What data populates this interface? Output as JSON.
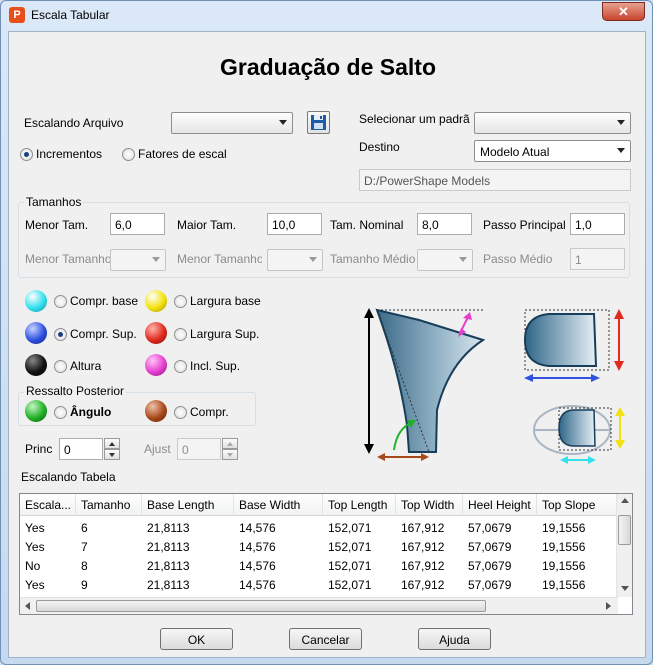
{
  "window": {
    "title": "Escala Tabular",
    "close": "✕"
  },
  "heading": "Graduação de Salto",
  "file": {
    "label": "Escalando Arquivo",
    "value": ""
  },
  "standard": {
    "label": "Selecionar um padrã",
    "value": ""
  },
  "mode": {
    "increments": "Incrementos",
    "factors": "Fatores de escal:",
    "selected": "increments"
  },
  "destination": {
    "label": "Destino",
    "value": "Modelo Atual",
    "path": "D:/PowerShape Models"
  },
  "sizes": {
    "title": "Tamanhos",
    "min_label": "Menor Tam.",
    "min": "6,0",
    "max_label": "Maior Tam.",
    "max": "10,0",
    "nominal_label": "Tam. Nominal",
    "nominal": "8,0",
    "step_label": "Passo Principal",
    "step": "1,0",
    "min2_label": "Menor Tamanho",
    "mid_label": "Tamanho Médio",
    "mid_step_label": "Passo Médio",
    "mid_step": "1"
  },
  "options": {
    "base_length": "Compr. base",
    "base_width": "Largura base",
    "top_length": "Compr. Sup.",
    "top_width": "Largura Sup.",
    "height": "Altura",
    "top_slope": "Incl. Sup.",
    "selected": "top_length"
  },
  "heel_back": {
    "title": "Ressalto Posterior",
    "angle": "Ângulo",
    "length": "Compr."
  },
  "princ": {
    "label": "Princ",
    "value": "0"
  },
  "ajust": {
    "label": "Ajust",
    "value": "0"
  },
  "table": {
    "title": "Escalando Tabela",
    "columns": [
      "Escala...",
      "Tamanho",
      "Base Length",
      "Base Width",
      "Top Length",
      "Top Width",
      "Heel Height",
      "Top Slope"
    ],
    "rows": [
      [
        "Yes",
        "6",
        "21,8113",
        "14,576",
        "152,071",
        "167,912",
        "57,0679",
        "19,1556"
      ],
      [
        "Yes",
        "7",
        "21,8113",
        "14,576",
        "152,071",
        "167,912",
        "57,0679",
        "19,1556"
      ],
      [
        "No",
        "8",
        "21,8113",
        "14,576",
        "152,071",
        "167,912",
        "57,0679",
        "19,1556"
      ],
      [
        "Yes",
        "9",
        "21,8113",
        "14,576",
        "152,071",
        "167,912",
        "57,0679",
        "19,1556"
      ]
    ]
  },
  "buttons": {
    "ok": "OK",
    "cancel": "Cancelar",
    "help": "Ajuda"
  },
  "colors": {
    "cyan": "#34e0ee",
    "blue": "#2f52e0",
    "black": "#111111",
    "yellow": "#f3e20c",
    "red": "#e02b1d",
    "magenta": "#e63fd0",
    "green": "#22b126",
    "brown": "#a8491c"
  }
}
